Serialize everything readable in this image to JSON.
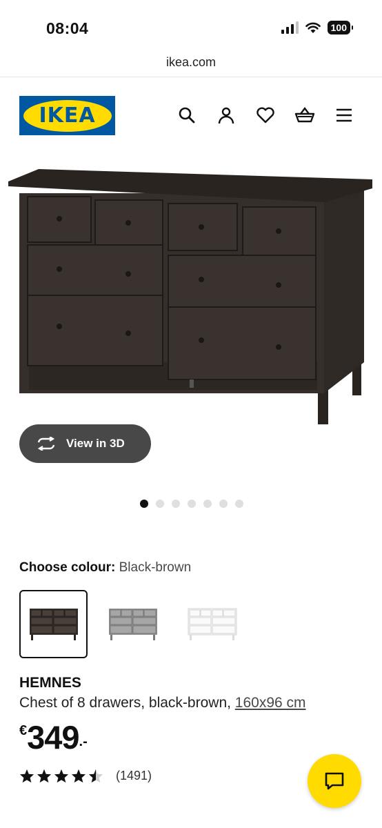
{
  "status_bar": {
    "time": "08:04",
    "battery": "100"
  },
  "browser": {
    "url": "ikea.com"
  },
  "header": {
    "logo_text": "IKEA",
    "icons": [
      "search-icon",
      "account-icon",
      "heart-icon",
      "basket-icon",
      "menu-icon"
    ]
  },
  "product_media": {
    "view_3d_label": "View in 3D",
    "carousel": {
      "total": 7,
      "active_index": 1
    }
  },
  "colour": {
    "label": "Choose colour:",
    "selected": "Black-brown",
    "options_count": 3
  },
  "product": {
    "name": "HEMNES",
    "description": "Chest of 8 drawers, black-brown, ",
    "dimensions": "160x96 cm",
    "price_currency": "€",
    "price_amount": "349",
    "price_suffix": ".-",
    "rating": 4.5,
    "review_count": "(1491)"
  },
  "colors": {
    "ikea_blue": "#0058a3",
    "ikea_yellow": "#ffdb00",
    "button_dark": "#484848"
  }
}
